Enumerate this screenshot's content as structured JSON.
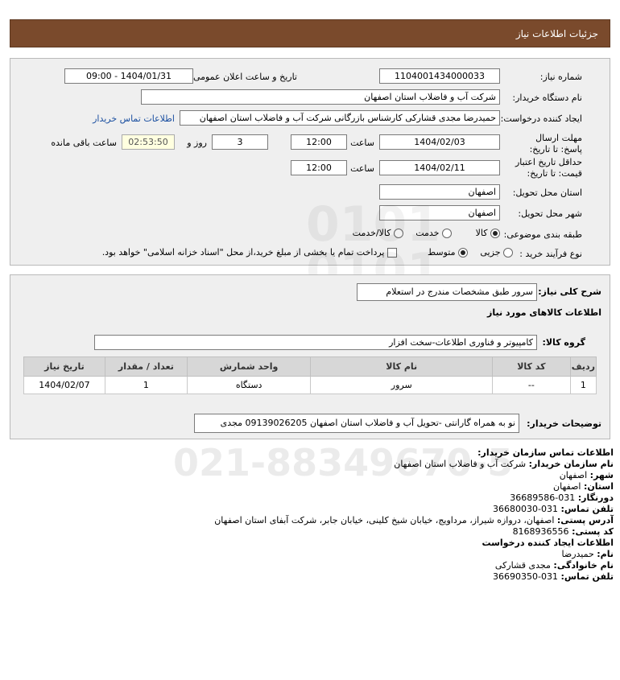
{
  "header": {
    "title": "جزئیات اطلاعات نیاز"
  },
  "form": {
    "need_number_label": "شماره نیاز:",
    "need_number": "1104001434000033",
    "announce_label": "تاریخ و ساعت اعلان عمومی:",
    "announce_value": "1404/01/31 - 09:00",
    "buyer_org_label": "نام دستگاه خریدار:",
    "buyer_org": "شرکت آب و فاضلاب استان اصفهان",
    "creator_label": "ایجاد کننده درخواست:",
    "creator": "حمیدرضا مجدی قشارکی کارشناس بازرگانی شرکت آب و فاضلاب استان اصفهان",
    "contact_link": "اطلاعات تماس خریدار",
    "deadline_label": "مهلت ارسال پاسخ: تا تاریخ:",
    "deadline_date": "1404/02/03",
    "time_label": "ساعت",
    "deadline_time": "12:00",
    "days_value": "3",
    "days_label": "روز و",
    "remaining_time": "02:53:50",
    "remaining_label": "ساعت باقی مانده",
    "validity_label": "حداقل تاریخ اعتبار قیمت: تا تاریخ:",
    "validity_date": "1404/02/11",
    "validity_time": "12:00",
    "province_label": "استان محل تحویل:",
    "province": "اصفهان",
    "city_label": "شهر محل تحویل:",
    "city": "اصفهان",
    "category_label": "طبقه بندی موضوعی:",
    "category_options": [
      "کالا",
      "خدمت",
      "کالا/خدمت"
    ],
    "category_selected": "کالا",
    "process_label": "نوع فرآیند خرید :",
    "process_options": [
      "جزیی",
      "متوسط"
    ],
    "process_selected": "متوسط",
    "payment_note": "پرداخت تمام یا بخشی از مبلغ خرید،از محل \"اسناد خزانه اسلامی\" خواهد بود."
  },
  "details": {
    "summary_label": "شرح کلی نیاز:",
    "summary": "سرور طبق مشخصات مندرج در استعلام",
    "goods_info_title": "اطلاعات کالاهای مورد نیاز",
    "group_label": "گروه کالا:",
    "group_value": "کامپیوتر و فناوری اطلاعات-سخت افزار",
    "table": {
      "headers": [
        "ردیف",
        "کد کالا",
        "نام کالا",
        "واحد شمارش",
        "تعداد / مقدار",
        "تاریخ نیاز"
      ],
      "rows": [
        [
          "1",
          "--",
          "سرور",
          "دستگاه",
          "1",
          "1404/02/07"
        ]
      ]
    },
    "buyer_desc_label": "توضیحات خریدار:",
    "buyer_desc": "نو به همراه گارانتی -تحویل آب و فاضلاب استان اصفهان 09139026205 مجدی"
  },
  "contact": {
    "title": "اطلاعات تماس سازمان خریدار:",
    "org_label": "نام سازمان خریدار:",
    "org": "شرکت آب و فاضلاب استان اصفهان",
    "city_label": "شهر:",
    "city": "اصفهان",
    "province_label": "استان:",
    "province": "اصفهان",
    "fax_label": "دورنگار:",
    "fax": "031-36689586",
    "phone_label": "تلفن تماس:",
    "phone": "031-36680030",
    "address_label": "آدرس پستی:",
    "address": "اصفهان، دروازه شیراز، مرداویج، خیابان شیخ کلینی، خیابان جابر، شرکت آبفای استان اصفهان",
    "postal_label": "کد پستی:",
    "postal": "8168936556",
    "creator_title": "اطلاعات ایجاد کننده درخواست",
    "name_label": "نام:",
    "name": "حمیدرضا",
    "family_label": "نام خانوادگی:",
    "family": "مجدی قشارکی",
    "creator_phone_label": "تلفن تماس:",
    "creator_phone": "031-36690350"
  },
  "colors": {
    "header_bg": "#7a4a2c",
    "panel_bg": "#efefef",
    "link": "#1a4fa0"
  }
}
